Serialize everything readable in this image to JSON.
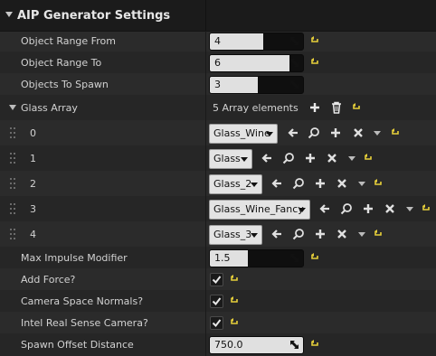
{
  "panel": {
    "title": "AIP Generator Settings"
  },
  "props": {
    "object_range_from": {
      "label": "Object Range From",
      "value": "4",
      "fill": 0.5
    },
    "object_range_to": {
      "label": "Object Range To",
      "value": "6",
      "fill": 0.85
    },
    "objects_to_spawn": {
      "label": "Objects To Spawn",
      "value": "3",
      "fill": 0.45
    },
    "max_impulse_modifier": {
      "label": "Max Impulse Modifier",
      "value": "1.5",
      "fill": 0.4
    },
    "spawn_offset_distance": {
      "label": "Spawn Offset Distance",
      "value": "750.0"
    }
  },
  "glass_array": {
    "label": "Glass Array",
    "count_text": "5 Array elements",
    "elements": [
      {
        "index": "0",
        "value": "Glass_Wine"
      },
      {
        "index": "1",
        "value": "Glass"
      },
      {
        "index": "2",
        "value": "Glass_2"
      },
      {
        "index": "3",
        "value": "Glass_Wine_Fancy"
      },
      {
        "index": "4",
        "value": "Glass_3"
      }
    ]
  },
  "checks": {
    "add_force": {
      "label": "Add Force?",
      "checked": true
    },
    "camera_space_normals": {
      "label": "Camera Space Normals?",
      "checked": true
    },
    "intel_real_sense_camera": {
      "label": "Intel Real Sense Camera?",
      "checked": true
    }
  },
  "colors": {
    "fill": "#e0e0e0",
    "reset_arrow": "#e6cf3a",
    "background": "#2b2b2b",
    "header": "#1b1b1b"
  }
}
